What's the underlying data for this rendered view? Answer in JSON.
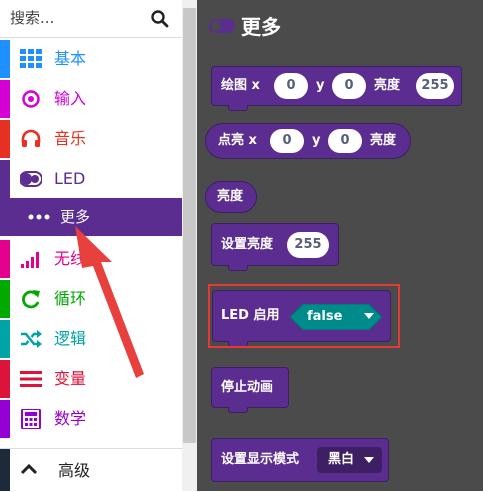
{
  "search": {
    "placeholder": "搜索..."
  },
  "categories": [
    {
      "label": "基本",
      "color": "#1e90ff",
      "icon": "grid-icon"
    },
    {
      "label": "输入",
      "color": "#d400d4",
      "icon": "target-icon"
    },
    {
      "label": "音乐",
      "color": "#e63022",
      "icon": "headphones-icon"
    },
    {
      "label": "LED",
      "color": "#5c2d91",
      "icon": "toggle-icon"
    },
    {
      "label": "更多",
      "color": "#5c2d91",
      "icon": "more-icon",
      "selected": true
    },
    {
      "label": "无线",
      "color": "#e3008c",
      "icon": "signal-icon"
    },
    {
      "label": "循环",
      "color": "#00aa00",
      "icon": "loop-icon"
    },
    {
      "label": "逻辑",
      "color": "#00a4a6",
      "icon": "shuffle-icon"
    },
    {
      "label": "变量",
      "color": "#dc143c",
      "icon": "lines-icon"
    },
    {
      "label": "数学",
      "color": "#9400d3",
      "icon": "calculator-icon"
    }
  ],
  "advanced": {
    "label": "高级",
    "icon": "chevron-up-icon"
  },
  "flyout": {
    "title": "更多",
    "blocks": {
      "plot_brightness": {
        "label": "绘图 x",
        "y_label": "y",
        "brightness_label": "亮度",
        "x": "0",
        "y": "0",
        "brightness": "255"
      },
      "point": {
        "label": "点亮 x",
        "y_label": "y",
        "brightness_label": "亮度",
        "x": "0",
        "y": "0"
      },
      "brightness": {
        "label": "亮度"
      },
      "set_brightness": {
        "label": "设置亮度",
        "value": "255"
      },
      "led_enable": {
        "label": "LED 启用",
        "value": "false"
      },
      "stop_animation": {
        "label": "停止动画"
      },
      "display_mode": {
        "label": "设置显示模式",
        "value": "黑白"
      }
    }
  },
  "colors": {
    "accent": "#5c2d91",
    "flyout_bg": "#4b4b4b",
    "boolean": "#008b8b",
    "highlight": "#e43a36"
  }
}
